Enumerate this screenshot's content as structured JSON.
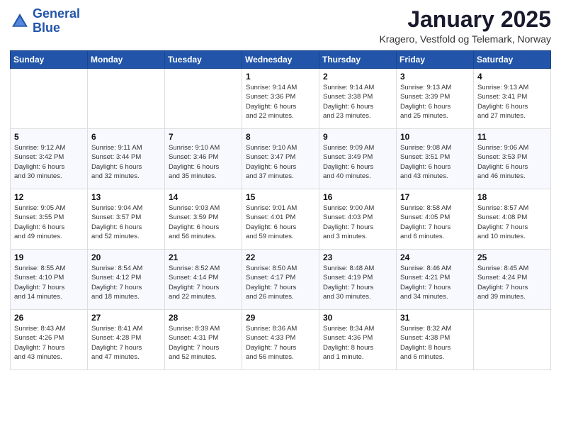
{
  "header": {
    "logo_line1": "General",
    "logo_line2": "Blue",
    "month_title": "January 2025",
    "location": "Kragero, Vestfold og Telemark, Norway"
  },
  "weekdays": [
    "Sunday",
    "Monday",
    "Tuesday",
    "Wednesday",
    "Thursday",
    "Friday",
    "Saturday"
  ],
  "weeks": [
    [
      {
        "day": "",
        "info": ""
      },
      {
        "day": "",
        "info": ""
      },
      {
        "day": "",
        "info": ""
      },
      {
        "day": "1",
        "info": "Sunrise: 9:14 AM\nSunset: 3:36 PM\nDaylight: 6 hours\nand 22 minutes."
      },
      {
        "day": "2",
        "info": "Sunrise: 9:14 AM\nSunset: 3:38 PM\nDaylight: 6 hours\nand 23 minutes."
      },
      {
        "day": "3",
        "info": "Sunrise: 9:13 AM\nSunset: 3:39 PM\nDaylight: 6 hours\nand 25 minutes."
      },
      {
        "day": "4",
        "info": "Sunrise: 9:13 AM\nSunset: 3:41 PM\nDaylight: 6 hours\nand 27 minutes."
      }
    ],
    [
      {
        "day": "5",
        "info": "Sunrise: 9:12 AM\nSunset: 3:42 PM\nDaylight: 6 hours\nand 30 minutes."
      },
      {
        "day": "6",
        "info": "Sunrise: 9:11 AM\nSunset: 3:44 PM\nDaylight: 6 hours\nand 32 minutes."
      },
      {
        "day": "7",
        "info": "Sunrise: 9:10 AM\nSunset: 3:46 PM\nDaylight: 6 hours\nand 35 minutes."
      },
      {
        "day": "8",
        "info": "Sunrise: 9:10 AM\nSunset: 3:47 PM\nDaylight: 6 hours\nand 37 minutes."
      },
      {
        "day": "9",
        "info": "Sunrise: 9:09 AM\nSunset: 3:49 PM\nDaylight: 6 hours\nand 40 minutes."
      },
      {
        "day": "10",
        "info": "Sunrise: 9:08 AM\nSunset: 3:51 PM\nDaylight: 6 hours\nand 43 minutes."
      },
      {
        "day": "11",
        "info": "Sunrise: 9:06 AM\nSunset: 3:53 PM\nDaylight: 6 hours\nand 46 minutes."
      }
    ],
    [
      {
        "day": "12",
        "info": "Sunrise: 9:05 AM\nSunset: 3:55 PM\nDaylight: 6 hours\nand 49 minutes."
      },
      {
        "day": "13",
        "info": "Sunrise: 9:04 AM\nSunset: 3:57 PM\nDaylight: 6 hours\nand 52 minutes."
      },
      {
        "day": "14",
        "info": "Sunrise: 9:03 AM\nSunset: 3:59 PM\nDaylight: 6 hours\nand 56 minutes."
      },
      {
        "day": "15",
        "info": "Sunrise: 9:01 AM\nSunset: 4:01 PM\nDaylight: 6 hours\nand 59 minutes."
      },
      {
        "day": "16",
        "info": "Sunrise: 9:00 AM\nSunset: 4:03 PM\nDaylight: 7 hours\nand 3 minutes."
      },
      {
        "day": "17",
        "info": "Sunrise: 8:58 AM\nSunset: 4:05 PM\nDaylight: 7 hours\nand 6 minutes."
      },
      {
        "day": "18",
        "info": "Sunrise: 8:57 AM\nSunset: 4:08 PM\nDaylight: 7 hours\nand 10 minutes."
      }
    ],
    [
      {
        "day": "19",
        "info": "Sunrise: 8:55 AM\nSunset: 4:10 PM\nDaylight: 7 hours\nand 14 minutes."
      },
      {
        "day": "20",
        "info": "Sunrise: 8:54 AM\nSunset: 4:12 PM\nDaylight: 7 hours\nand 18 minutes."
      },
      {
        "day": "21",
        "info": "Sunrise: 8:52 AM\nSunset: 4:14 PM\nDaylight: 7 hours\nand 22 minutes."
      },
      {
        "day": "22",
        "info": "Sunrise: 8:50 AM\nSunset: 4:17 PM\nDaylight: 7 hours\nand 26 minutes."
      },
      {
        "day": "23",
        "info": "Sunrise: 8:48 AM\nSunset: 4:19 PM\nDaylight: 7 hours\nand 30 minutes."
      },
      {
        "day": "24",
        "info": "Sunrise: 8:46 AM\nSunset: 4:21 PM\nDaylight: 7 hours\nand 34 minutes."
      },
      {
        "day": "25",
        "info": "Sunrise: 8:45 AM\nSunset: 4:24 PM\nDaylight: 7 hours\nand 39 minutes."
      }
    ],
    [
      {
        "day": "26",
        "info": "Sunrise: 8:43 AM\nSunset: 4:26 PM\nDaylight: 7 hours\nand 43 minutes."
      },
      {
        "day": "27",
        "info": "Sunrise: 8:41 AM\nSunset: 4:28 PM\nDaylight: 7 hours\nand 47 minutes."
      },
      {
        "day": "28",
        "info": "Sunrise: 8:39 AM\nSunset: 4:31 PM\nDaylight: 7 hours\nand 52 minutes."
      },
      {
        "day": "29",
        "info": "Sunrise: 8:36 AM\nSunset: 4:33 PM\nDaylight: 7 hours\nand 56 minutes."
      },
      {
        "day": "30",
        "info": "Sunrise: 8:34 AM\nSunset: 4:36 PM\nDaylight: 8 hours\nand 1 minute."
      },
      {
        "day": "31",
        "info": "Sunrise: 8:32 AM\nSunset: 4:38 PM\nDaylight: 8 hours\nand 6 minutes."
      },
      {
        "day": "",
        "info": ""
      }
    ]
  ]
}
